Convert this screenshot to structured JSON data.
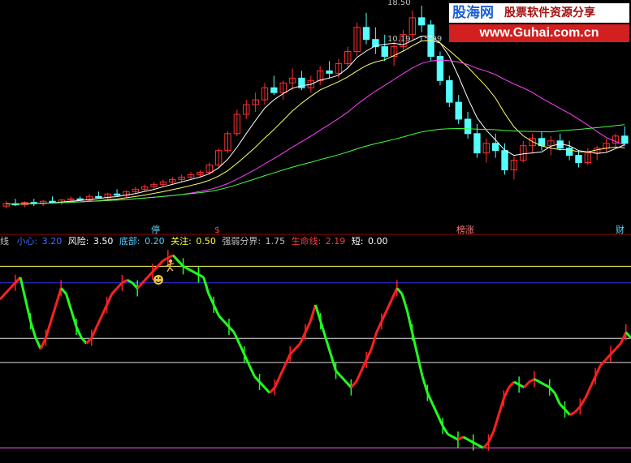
{
  "price_panel": {
    "top_price": "18.50",
    "range_label": "10.19 - 15.99",
    "markers": [
      {
        "text": "停",
        "color": "#5fd7ff"
      },
      {
        "text": "$",
        "color": "#ff3a3a"
      },
      {
        "text": "榜涨",
        "color": "#ff7a7a"
      },
      {
        "text": "财",
        "color": "#5fd7ff"
      }
    ]
  },
  "indicator_bar": {
    "items": [
      {
        "label": "线",
        "value": "",
        "color": "#c0c0c0"
      },
      {
        "label": "小心:",
        "value": "3.20",
        "color": "#3b6cff"
      },
      {
        "label": "风险:",
        "value": "3.50",
        "color": "#ffffff"
      },
      {
        "label": "底部:",
        "value": "0.20",
        "color": "#50d0ff"
      },
      {
        "label": "关注:",
        "value": "0.50",
        "color": "#ffff3c"
      },
      {
        "label": "强弱分界:",
        "value": "1.75",
        "color": "#c0c0c0"
      },
      {
        "label": "生命线:",
        "value": "2.19",
        "color": "#ff3a3a"
      },
      {
        "label": "短:",
        "value": "0.00",
        "color": "#ffffff"
      }
    ]
  },
  "watermark": {
    "name": "股海网",
    "slogan": "股票软件资源分享",
    "url": "www.Guhai.com.cn"
  },
  "colors": {
    "up": "#ff3030",
    "down": "#54ffff",
    "ma5": "#ffffff",
    "ma10": "#ffff66",
    "ma20": "#ff40ff",
    "ma60": "#40ff40",
    "ind_up": "#ff2020",
    "ind_down": "#20ff20",
    "line_top": "#ffff60",
    "line_blue": "#3030ff",
    "line_mid": "#e0e0e0",
    "line_low": "#ff60ff"
  },
  "chart_data": [
    {
      "type": "candlestick",
      "title": "",
      "ylim": [
        9.5,
        18.6
      ],
      "ohlc": [
        [
          10.2,
          10.4,
          10.1,
          10.3
        ],
        [
          10.3,
          10.5,
          10.2,
          10.25
        ],
        [
          10.25,
          10.4,
          10.15,
          10.35
        ],
        [
          10.35,
          10.5,
          10.2,
          10.3
        ],
        [
          10.3,
          10.45,
          10.2,
          10.4
        ],
        [
          10.4,
          10.6,
          10.3,
          10.35
        ],
        [
          10.35,
          10.5,
          10.25,
          10.45
        ],
        [
          10.45,
          10.6,
          10.35,
          10.5
        ],
        [
          10.5,
          10.6,
          10.4,
          10.45
        ],
        [
          10.45,
          10.7,
          10.4,
          10.6
        ],
        [
          10.6,
          10.8,
          10.5,
          10.55
        ],
        [
          10.55,
          10.75,
          10.45,
          10.7
        ],
        [
          10.7,
          10.9,
          10.6,
          10.65
        ],
        [
          10.65,
          10.85,
          10.55,
          10.8
        ],
        [
          10.8,
          11.0,
          10.7,
          10.9
        ],
        [
          10.9,
          11.1,
          10.8,
          11.0
        ],
        [
          11.0,
          11.2,
          10.9,
          11.1
        ],
        [
          11.1,
          11.3,
          11.0,
          11.2
        ],
        [
          11.2,
          11.4,
          11.1,
          11.3
        ],
        [
          11.3,
          11.5,
          11.2,
          11.4
        ],
        [
          11.4,
          11.6,
          11.3,
          11.5
        ],
        [
          11.5,
          11.7,
          11.4,
          11.6
        ],
        [
          11.6,
          12.0,
          11.5,
          11.9
        ],
        [
          11.9,
          12.6,
          11.8,
          12.5
        ],
        [
          12.5,
          13.3,
          12.4,
          13.2
        ],
        [
          13.2,
          14.2,
          13.1,
          14.0
        ],
        [
          14.0,
          14.6,
          13.8,
          14.4
        ],
        [
          14.4,
          14.9,
          14.1,
          14.6
        ],
        [
          14.6,
          15.3,
          14.4,
          15.1
        ],
        [
          15.1,
          15.6,
          14.8,
          14.9
        ],
        [
          14.9,
          15.4,
          14.6,
          15.3
        ],
        [
          15.3,
          15.9,
          15.0,
          15.5
        ],
        [
          15.5,
          15.8,
          15.0,
          15.1
        ],
        [
          15.1,
          15.6,
          14.9,
          15.4
        ],
        [
          15.4,
          16.0,
          15.2,
          15.8
        ],
        [
          15.8,
          16.2,
          15.5,
          15.7
        ],
        [
          15.7,
          16.3,
          15.5,
          16.1
        ],
        [
          16.1,
          16.8,
          15.9,
          16.6
        ],
        [
          16.6,
          17.8,
          16.4,
          17.6
        ],
        [
          17.6,
          18.2,
          16.9,
          17.1
        ],
        [
          17.1,
          17.6,
          16.5,
          16.8
        ],
        [
          16.8,
          17.3,
          16.2,
          16.4
        ],
        [
          16.4,
          17.0,
          16.0,
          16.8
        ],
        [
          16.8,
          17.5,
          16.6,
          17.3
        ],
        [
          17.3,
          18.3,
          17.1,
          18.0
        ],
        [
          18.0,
          18.5,
          17.4,
          17.7
        ],
        [
          17.7,
          17.9,
          16.2,
          16.4
        ],
        [
          16.4,
          16.6,
          15.2,
          15.4
        ],
        [
          15.4,
          15.6,
          14.3,
          14.5
        ],
        [
          14.5,
          14.8,
          13.6,
          13.8
        ],
        [
          13.8,
          14.1,
          13.0,
          13.2
        ],
        [
          13.2,
          13.6,
          12.2,
          12.4
        ],
        [
          12.4,
          13.0,
          12.0,
          12.8
        ],
        [
          12.8,
          13.2,
          12.2,
          12.5
        ],
        [
          12.5,
          12.8,
          11.5,
          11.7
        ],
        [
          11.7,
          12.3,
          11.3,
          12.1
        ],
        [
          12.1,
          12.9,
          12.0,
          12.7
        ],
        [
          12.7,
          13.2,
          12.4,
          13.0
        ],
        [
          13.0,
          13.3,
          12.5,
          12.7
        ],
        [
          12.7,
          13.1,
          12.3,
          12.9
        ],
        [
          12.9,
          13.2,
          12.5,
          12.6
        ],
        [
          12.6,
          12.9,
          12.1,
          12.3
        ],
        [
          12.3,
          12.5,
          11.8,
          12.0
        ],
        [
          12.0,
          12.6,
          11.9,
          12.4
        ],
        [
          12.4,
          12.7,
          12.1,
          12.6
        ],
        [
          12.6,
          13.0,
          12.4,
          12.8
        ],
        [
          12.8,
          13.2,
          12.6,
          13.1
        ],
        [
          13.1,
          13.5,
          12.7,
          12.8
        ]
      ],
      "ma_periods": [
        5,
        10,
        20,
        60
      ]
    },
    {
      "type": "line",
      "title": "",
      "ylim": [
        0,
        3.8
      ],
      "reference_lines": [
        {
          "name": "风险",
          "y": 3.5
        },
        {
          "name": "小心",
          "y": 3.2
        },
        {
          "name": "强弱分界",
          "y": 1.75
        },
        {
          "name": "生命线",
          "y": 2.19
        },
        {
          "name": "底部",
          "y": 0.2
        }
      ],
      "series_y": [
        2.9,
        3.0,
        3.1,
        3.2,
        3.3,
        2.9,
        2.5,
        2.2,
        2.0,
        2.2,
        2.5,
        2.8,
        3.1,
        3.0,
        2.7,
        2.4,
        2.2,
        2.1,
        2.2,
        2.4,
        2.6,
        2.8,
        3.0,
        3.1,
        3.2,
        3.25,
        3.2,
        3.1,
        3.2,
        3.3,
        3.4,
        3.5,
        3.6,
        3.65,
        3.7,
        3.6,
        3.5,
        3.45,
        3.4,
        3.35,
        3.3,
        3.0,
        2.8,
        2.6,
        2.5,
        2.4,
        2.3,
        2.1,
        1.9,
        1.7,
        1.5,
        1.4,
        1.3,
        1.2,
        1.3,
        1.5,
        1.7,
        1.9,
        2.0,
        2.1,
        2.3,
        2.5,
        2.8,
        2.5,
        2.2,
        1.9,
        1.6,
        1.5,
        1.4,
        1.3,
        1.4,
        1.6,
        1.8,
        2.0,
        2.3,
        2.5,
        2.7,
        2.9,
        3.1,
        3.0,
        2.7,
        2.3,
        1.9,
        1.5,
        1.2,
        1.0,
        0.8,
        0.6,
        0.45,
        0.4,
        0.35,
        0.4,
        0.35,
        0.3,
        0.25,
        0.2,
        0.3,
        0.5,
        0.8,
        1.1,
        1.3,
        1.4,
        1.35,
        1.3,
        1.4,
        1.45,
        1.4,
        1.35,
        1.3,
        1.2,
        1.0,
        0.9,
        0.8,
        0.85,
        0.95,
        1.1,
        1.3,
        1.5,
        1.7,
        1.8,
        1.9,
        2.0,
        2.1,
        2.3,
        2.2
      ]
    }
  ]
}
